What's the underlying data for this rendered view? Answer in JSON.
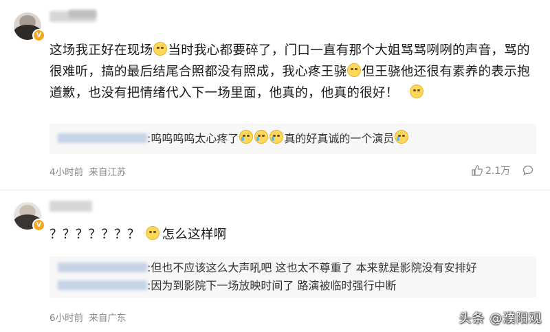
{
  "comments": [
    {
      "text_parts": [
        "这场我正好在现场",
        "当时我心都要碎了，门口一直有那个大姐骂骂咧咧的声音，骂的很难听，搞的最后结尾合照都没有照成，我心疼王骁",
        "但王骁他还很有素养的表示抱道歉，也没有把情绪代入下一场里面，他真的，他真的很好！"
      ],
      "reply": {
        "text": ":呜呜呜呜太心疼了",
        "text_after": "真的好真诚的一个演员"
      },
      "time": "4小时前",
      "location": "来自江苏",
      "likes": "2.1万"
    },
    {
      "text_parts": [
        "？？？？？？？",
        "怎么这样啊"
      ],
      "replies": [
        ":但也不应该这么大声吼吧 这也太不尊重了 本来就是影院没有安排好",
        ":因为到影院下一场放映时间了 路演被临时强行中断"
      ],
      "time": "6小时前",
      "location": "来自广东"
    }
  ],
  "watermark": "头条 @濮阳观",
  "colors": {
    "badge": "#f5a623",
    "meta": "#888888",
    "reply_bg": "#f7f7f7"
  }
}
